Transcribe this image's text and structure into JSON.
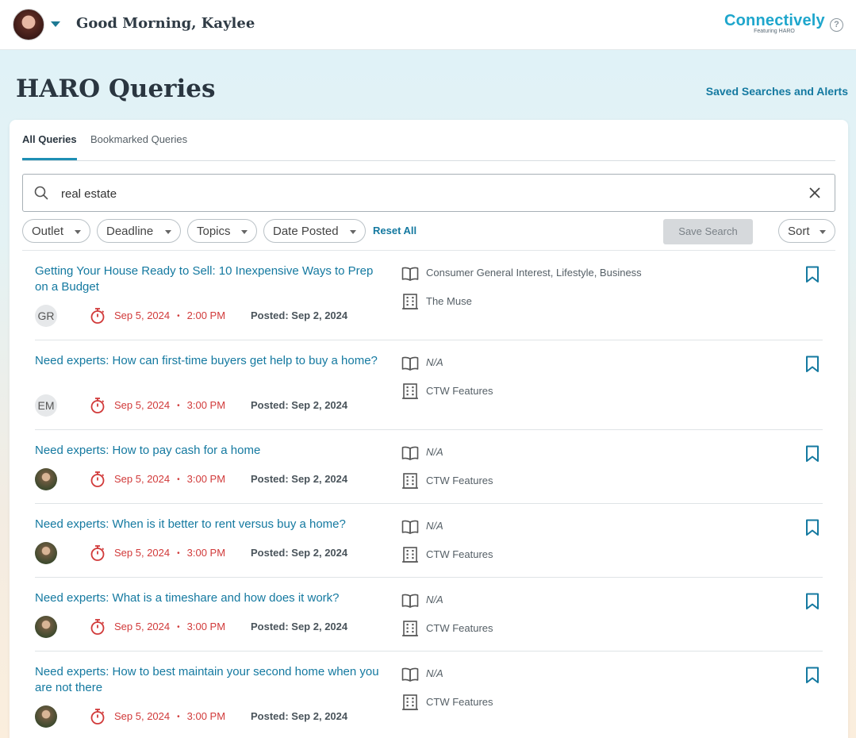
{
  "header": {
    "greeting": "Good Morning, Kaylee",
    "brand_name": "Connectively",
    "brand_sub": "Featuring HARO",
    "help_icon": "?"
  },
  "page": {
    "title": "HARO Queries",
    "saved_link": "Saved Searches and Alerts"
  },
  "tabs": [
    "All Queries",
    "Bookmarked Queries"
  ],
  "search": {
    "value": "real estate"
  },
  "filters": {
    "outlet": "Outlet",
    "deadline": "Deadline",
    "topics": "Topics",
    "date_posted": "Date Posted",
    "reset": "Reset All",
    "save_search": "Save Search",
    "sort": "Sort"
  },
  "colors": {
    "accent": "#1479a0",
    "deadline": "#d13a3a"
  },
  "queries": [
    {
      "title": "Getting Your House Ready to Sell: 10 Inexpensive Ways to Prep on a Budget",
      "avatar": "GR",
      "deadline_date": "Sep 5, 2024",
      "deadline_sep": "•",
      "deadline_time": "2:00 PM",
      "posted": "Posted: Sep 2, 2024",
      "topics": "Consumer General Interest, Lifestyle, Business",
      "outlet": "The Muse"
    },
    {
      "title": "Need experts: How can first-time buyers get help to buy a home?",
      "avatar": "EM",
      "deadline_date": "Sep 5, 2024",
      "deadline_sep": "•",
      "deadline_time": "3:00 PM",
      "posted": "Posted: Sep 2, 2024",
      "topics": "N/A",
      "outlet": "CTW Features"
    },
    {
      "title": "Need experts: How to pay cash for a home",
      "deadline_date": "Sep 5, 2024",
      "deadline_sep": "•",
      "deadline_time": "3:00 PM",
      "posted": "Posted: Sep 2, 2024",
      "topics": "N/A",
      "outlet": "CTW Features"
    },
    {
      "title": "Need experts: When is it better to rent versus buy a home?",
      "deadline_date": "Sep 5, 2024",
      "deadline_sep": "•",
      "deadline_time": "3:00 PM",
      "posted": "Posted: Sep 2, 2024",
      "topics": "N/A",
      "outlet": "CTW Features"
    },
    {
      "title": "Need experts: What is a timeshare and how does it work?",
      "deadline_date": "Sep 5, 2024",
      "deadline_sep": "•",
      "deadline_time": "3:00 PM",
      "posted": "Posted: Sep 2, 2024",
      "topics": "N/A",
      "outlet": "CTW Features"
    },
    {
      "title": "Need experts: How to best maintain your second home when you are not there",
      "deadline_date": "Sep 5, 2024",
      "deadline_sep": "•",
      "deadline_time": "3:00 PM",
      "posted": "Posted: Sep 2, 2024",
      "topics": "N/A",
      "outlet": "CTW Features"
    }
  ]
}
